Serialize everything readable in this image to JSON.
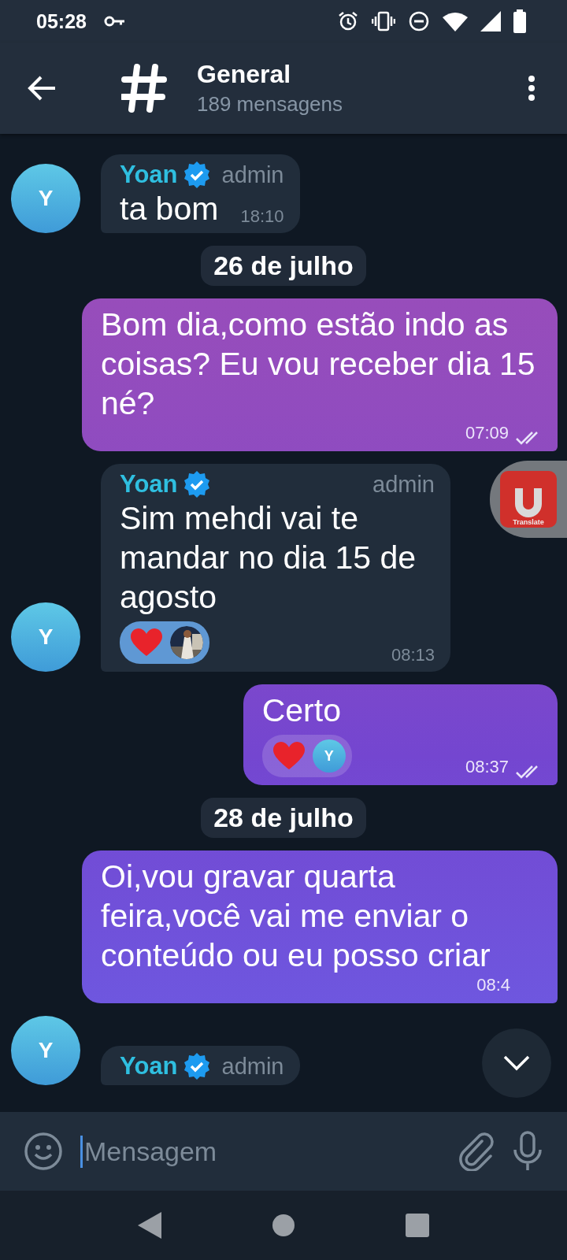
{
  "status_bar": {
    "time": "05:28"
  },
  "header": {
    "title": "General",
    "subtitle": "189 mensagens"
  },
  "messages": [
    {
      "kind": "in",
      "avatar": "Y",
      "sender": "Yoan",
      "verified": true,
      "role": "admin",
      "text": "ta bom",
      "time": "18:10"
    },
    {
      "kind": "date",
      "text": "26 de julho"
    },
    {
      "kind": "out",
      "text": "Bom dia,como estão indo as coisas? Eu vou receber dia 15 né?",
      "time": "07:09",
      "read": true
    },
    {
      "kind": "in",
      "avatar": "Y",
      "sender": "Yoan",
      "verified": true,
      "role": "admin",
      "text": "Sim mehdi vai te mandar no dia 15 de agosto",
      "time": "08:13"
    },
    {
      "kind": "out",
      "text": "Certo",
      "time": "08:37",
      "read": true,
      "reactions": [
        {
          "kind": "letter",
          "letter": "Y"
        }
      ]
    },
    {
      "kind": "date",
      "text": "28 de julho"
    },
    {
      "kind": "out",
      "text": "Oi,vou gravar quarta feira,você vai me enviar o conteúdo ou eu posso criar",
      "time": "08:4",
      "read": false
    },
    {
      "kind": "in",
      "avatar": "Y",
      "sender": "Yoan",
      "verified": true,
      "role": "admin"
    }
  ],
  "translate_widget": {
    "label": "Translate"
  },
  "composer": {
    "placeholder": "Mensagem"
  }
}
